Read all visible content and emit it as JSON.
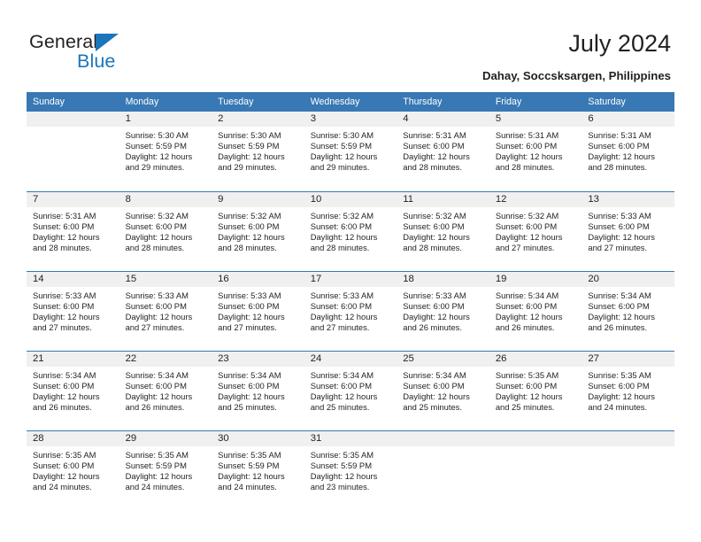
{
  "brand": {
    "name_part1": "General",
    "name_part2": "Blue",
    "accent_color": "#1b75bb"
  },
  "header": {
    "title": "July 2024",
    "location": "Dahay, Soccsksargen, Philippines"
  },
  "calendar": {
    "header_bg": "#3878b4",
    "datestrip_bg": "#f0f0f0",
    "weekdays": [
      "Sunday",
      "Monday",
      "Tuesday",
      "Wednesday",
      "Thursday",
      "Friday",
      "Saturday"
    ],
    "weeks": [
      [
        {
          "day": "",
          "empty": true
        },
        {
          "day": "1",
          "sunrise": "Sunrise: 5:30 AM",
          "sunset": "Sunset: 5:59 PM",
          "daylight": "Daylight: 12 hours and 29 minutes."
        },
        {
          "day": "2",
          "sunrise": "Sunrise: 5:30 AM",
          "sunset": "Sunset: 5:59 PM",
          "daylight": "Daylight: 12 hours and 29 minutes."
        },
        {
          "day": "3",
          "sunrise": "Sunrise: 5:30 AM",
          "sunset": "Sunset: 5:59 PM",
          "daylight": "Daylight: 12 hours and 29 minutes."
        },
        {
          "day": "4",
          "sunrise": "Sunrise: 5:31 AM",
          "sunset": "Sunset: 6:00 PM",
          "daylight": "Daylight: 12 hours and 28 minutes."
        },
        {
          "day": "5",
          "sunrise": "Sunrise: 5:31 AM",
          "sunset": "Sunset: 6:00 PM",
          "daylight": "Daylight: 12 hours and 28 minutes."
        },
        {
          "day": "6",
          "sunrise": "Sunrise: 5:31 AM",
          "sunset": "Sunset: 6:00 PM",
          "daylight": "Daylight: 12 hours and 28 minutes."
        }
      ],
      [
        {
          "day": "7",
          "sunrise": "Sunrise: 5:31 AM",
          "sunset": "Sunset: 6:00 PM",
          "daylight": "Daylight: 12 hours and 28 minutes."
        },
        {
          "day": "8",
          "sunrise": "Sunrise: 5:32 AM",
          "sunset": "Sunset: 6:00 PM",
          "daylight": "Daylight: 12 hours and 28 minutes."
        },
        {
          "day": "9",
          "sunrise": "Sunrise: 5:32 AM",
          "sunset": "Sunset: 6:00 PM",
          "daylight": "Daylight: 12 hours and 28 minutes."
        },
        {
          "day": "10",
          "sunrise": "Sunrise: 5:32 AM",
          "sunset": "Sunset: 6:00 PM",
          "daylight": "Daylight: 12 hours and 28 minutes."
        },
        {
          "day": "11",
          "sunrise": "Sunrise: 5:32 AM",
          "sunset": "Sunset: 6:00 PM",
          "daylight": "Daylight: 12 hours and 28 minutes."
        },
        {
          "day": "12",
          "sunrise": "Sunrise: 5:32 AM",
          "sunset": "Sunset: 6:00 PM",
          "daylight": "Daylight: 12 hours and 27 minutes."
        },
        {
          "day": "13",
          "sunrise": "Sunrise: 5:33 AM",
          "sunset": "Sunset: 6:00 PM",
          "daylight": "Daylight: 12 hours and 27 minutes."
        }
      ],
      [
        {
          "day": "14",
          "sunrise": "Sunrise: 5:33 AM",
          "sunset": "Sunset: 6:00 PM",
          "daylight": "Daylight: 12 hours and 27 minutes."
        },
        {
          "day": "15",
          "sunrise": "Sunrise: 5:33 AM",
          "sunset": "Sunset: 6:00 PM",
          "daylight": "Daylight: 12 hours and 27 minutes."
        },
        {
          "day": "16",
          "sunrise": "Sunrise: 5:33 AM",
          "sunset": "Sunset: 6:00 PM",
          "daylight": "Daylight: 12 hours and 27 minutes."
        },
        {
          "day": "17",
          "sunrise": "Sunrise: 5:33 AM",
          "sunset": "Sunset: 6:00 PM",
          "daylight": "Daylight: 12 hours and 27 minutes."
        },
        {
          "day": "18",
          "sunrise": "Sunrise: 5:33 AM",
          "sunset": "Sunset: 6:00 PM",
          "daylight": "Daylight: 12 hours and 26 minutes."
        },
        {
          "day": "19",
          "sunrise": "Sunrise: 5:34 AM",
          "sunset": "Sunset: 6:00 PM",
          "daylight": "Daylight: 12 hours and 26 minutes."
        },
        {
          "day": "20",
          "sunrise": "Sunrise: 5:34 AM",
          "sunset": "Sunset: 6:00 PM",
          "daylight": "Daylight: 12 hours and 26 minutes."
        }
      ],
      [
        {
          "day": "21",
          "sunrise": "Sunrise: 5:34 AM",
          "sunset": "Sunset: 6:00 PM",
          "daylight": "Daylight: 12 hours and 26 minutes."
        },
        {
          "day": "22",
          "sunrise": "Sunrise: 5:34 AM",
          "sunset": "Sunset: 6:00 PM",
          "daylight": "Daylight: 12 hours and 26 minutes."
        },
        {
          "day": "23",
          "sunrise": "Sunrise: 5:34 AM",
          "sunset": "Sunset: 6:00 PM",
          "daylight": "Daylight: 12 hours and 25 minutes."
        },
        {
          "day": "24",
          "sunrise": "Sunrise: 5:34 AM",
          "sunset": "Sunset: 6:00 PM",
          "daylight": "Daylight: 12 hours and 25 minutes."
        },
        {
          "day": "25",
          "sunrise": "Sunrise: 5:34 AM",
          "sunset": "Sunset: 6:00 PM",
          "daylight": "Daylight: 12 hours and 25 minutes."
        },
        {
          "day": "26",
          "sunrise": "Sunrise: 5:35 AM",
          "sunset": "Sunset: 6:00 PM",
          "daylight": "Daylight: 12 hours and 25 minutes."
        },
        {
          "day": "27",
          "sunrise": "Sunrise: 5:35 AM",
          "sunset": "Sunset: 6:00 PM",
          "daylight": "Daylight: 12 hours and 24 minutes."
        }
      ],
      [
        {
          "day": "28",
          "sunrise": "Sunrise: 5:35 AM",
          "sunset": "Sunset: 6:00 PM",
          "daylight": "Daylight: 12 hours and 24 minutes."
        },
        {
          "day": "29",
          "sunrise": "Sunrise: 5:35 AM",
          "sunset": "Sunset: 5:59 PM",
          "daylight": "Daylight: 12 hours and 24 minutes."
        },
        {
          "day": "30",
          "sunrise": "Sunrise: 5:35 AM",
          "sunset": "Sunset: 5:59 PM",
          "daylight": "Daylight: 12 hours and 24 minutes."
        },
        {
          "day": "31",
          "sunrise": "Sunrise: 5:35 AM",
          "sunset": "Sunset: 5:59 PM",
          "daylight": "Daylight: 12 hours and 23 minutes."
        },
        {
          "day": "",
          "empty": true
        },
        {
          "day": "",
          "empty": true
        },
        {
          "day": "",
          "empty": true
        }
      ]
    ]
  }
}
